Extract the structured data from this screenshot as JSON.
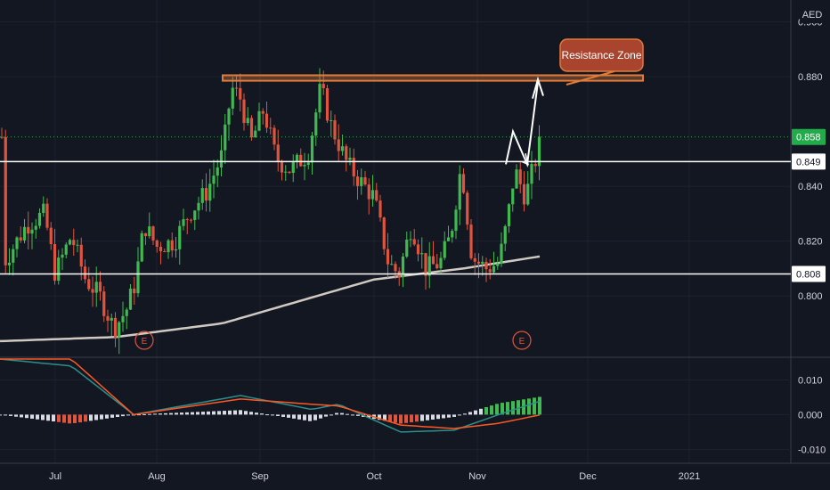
{
  "currency": "AED",
  "annotation": {
    "label": "Resistance Zone"
  },
  "earnings_marker": "E",
  "colors": {
    "background": "#131722",
    "up": "#26a69a",
    "up_candle": "#3fb950",
    "down": "#ef5350",
    "down_candle": "#e0533d",
    "ma": "#cfc9c1",
    "macd": "#2b8f8c",
    "signal": "#ff5722",
    "resistance": "#e07b39",
    "last_price": "#22ab4a"
  },
  "chart_data": [
    {
      "type": "candlestick",
      "ylim": [
        0.776,
        0.906
      ],
      "y_ticks": [
        "0.900",
        "0.880",
        "0.840",
        "0.820",
        "0.800"
      ],
      "x_ticks": [
        "Jul",
        "Aug",
        "Sep",
        "Oct",
        "Nov",
        "Dec",
        "2021"
      ],
      "price_labels": {
        "last": "0.858",
        "upper_support": "0.849",
        "lower_support": "0.808"
      },
      "levels": {
        "last": 0.858,
        "upper_support": 0.849,
        "lower_support": 0.808
      },
      "resistance_zone": [
        0.8785,
        0.8805
      ],
      "earnings_dates": [
        "Jul",
        "Nov"
      ],
      "candles_summary": [
        {
          "period": "Jul",
          "open": 0.818,
          "high": 0.836,
          "low": 0.8,
          "close": 0.828
        },
        {
          "period": "mid-Jul",
          "open": 0.815,
          "high": 0.826,
          "low": 0.79,
          "close": 0.795
        },
        {
          "period": "Aug",
          "open": 0.815,
          "high": 0.85,
          "low": 0.805,
          "close": 0.838
        },
        {
          "period": "late-Aug",
          "open": 0.855,
          "high": 0.885,
          "low": 0.85,
          "close": 0.878
        },
        {
          "period": "Sep",
          "open": 0.87,
          "high": 0.872,
          "low": 0.84,
          "close": 0.85
        },
        {
          "period": "mid-Sep",
          "open": 0.85,
          "high": 0.885,
          "low": 0.84,
          "close": 0.878
        },
        {
          "period": "Oct",
          "open": 0.845,
          "high": 0.85,
          "low": 0.8,
          "close": 0.81
        },
        {
          "period": "late-Oct",
          "open": 0.83,
          "high": 0.868,
          "low": 0.808,
          "close": 0.845
        },
        {
          "period": "Nov",
          "open": 0.815,
          "high": 0.83,
          "low": 0.806,
          "close": 0.81
        },
        {
          "period": "mid-Nov",
          "open": 0.825,
          "high": 0.866,
          "low": 0.82,
          "close": 0.858
        }
      ],
      "moving_average": [
        {
          "period": "early-Jul",
          "value": 0.785
        },
        {
          "period": "Aug",
          "value": 0.787
        },
        {
          "period": "Sep",
          "value": 0.797
        },
        {
          "period": "Oct",
          "value": 0.807
        },
        {
          "period": "Nov",
          "value": 0.81
        },
        {
          "period": "mid-Nov",
          "value": 0.814
        }
      ]
    },
    {
      "type": "macd",
      "ylim": [
        -0.014,
        0.016
      ],
      "y_ticks": [
        "0.010",
        "0.000",
        "-0.010"
      ],
      "x_ticks": [
        "Jul",
        "Aug",
        "Sep",
        "Oct",
        "Nov",
        "Dec",
        "2021"
      ]
    }
  ]
}
